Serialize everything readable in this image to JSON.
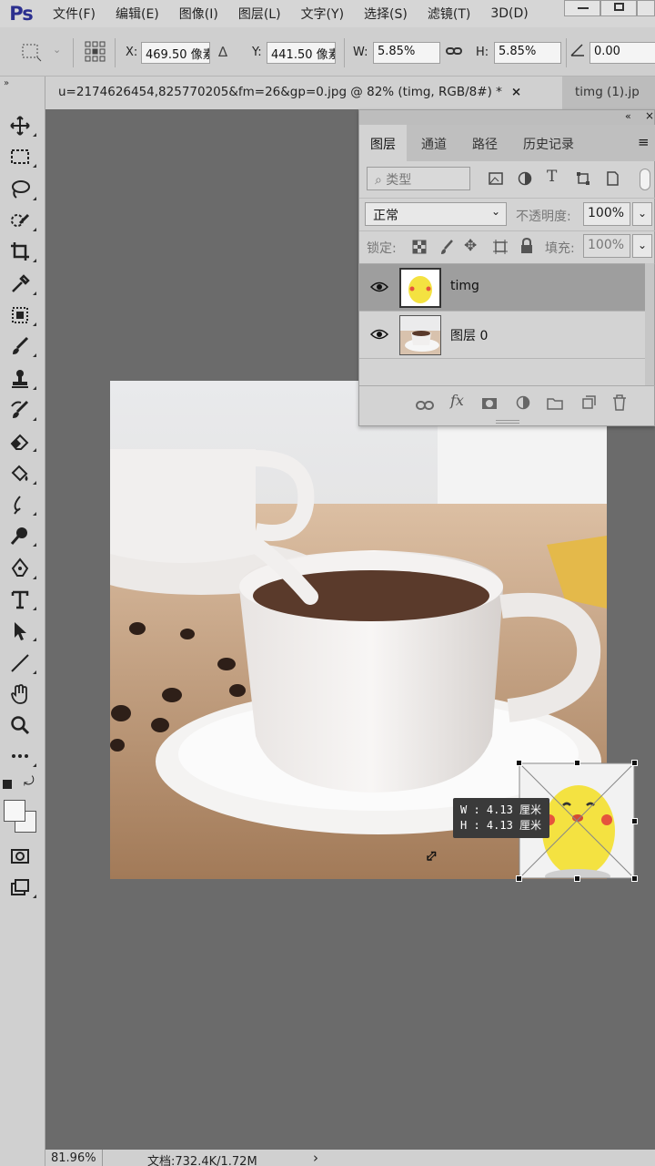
{
  "app": {
    "logo": "Ps"
  },
  "menu": [
    "文件(F)",
    "编辑(E)",
    "图像(I)",
    "图层(L)",
    "文字(Y)",
    "选择(S)",
    "滤镜(T)",
    "3D(D)"
  ],
  "options": {
    "x_label": "X:",
    "x_value": "469.50 像素",
    "y_label": "Y:",
    "y_value": "441.50 像素",
    "w_label": "W:",
    "w_value": "5.85%",
    "h_label": "H:",
    "h_value": "5.85%",
    "angle_value": "0.00"
  },
  "tabs": [
    {
      "label": "u=2174626454,825770205&fm=26&gp=0.jpg @ 82% (timg, RGB/8#) *",
      "close": "×"
    },
    {
      "label": "timg (1).jp"
    }
  ],
  "layers_panel": {
    "tabs": [
      "图层",
      "通道",
      "路径",
      "历史记录"
    ],
    "filter_placeholder": "类型",
    "blend_mode": "正常",
    "opacity_label": "不透明度:",
    "opacity_value": "100%",
    "lock_label": "锁定:",
    "fill_label": "填充:",
    "fill_value": "100%",
    "layers": [
      {
        "name": "timg",
        "selected": true
      },
      {
        "name": "图层 0",
        "selected": false
      }
    ]
  },
  "transform_tooltip": {
    "w": "W : 4.13 厘米",
    "h": "H : 4.13 厘米"
  },
  "status": {
    "zoom": "81.96%",
    "doc": "文档:732.4K/1.72M",
    "arrow": "›"
  }
}
